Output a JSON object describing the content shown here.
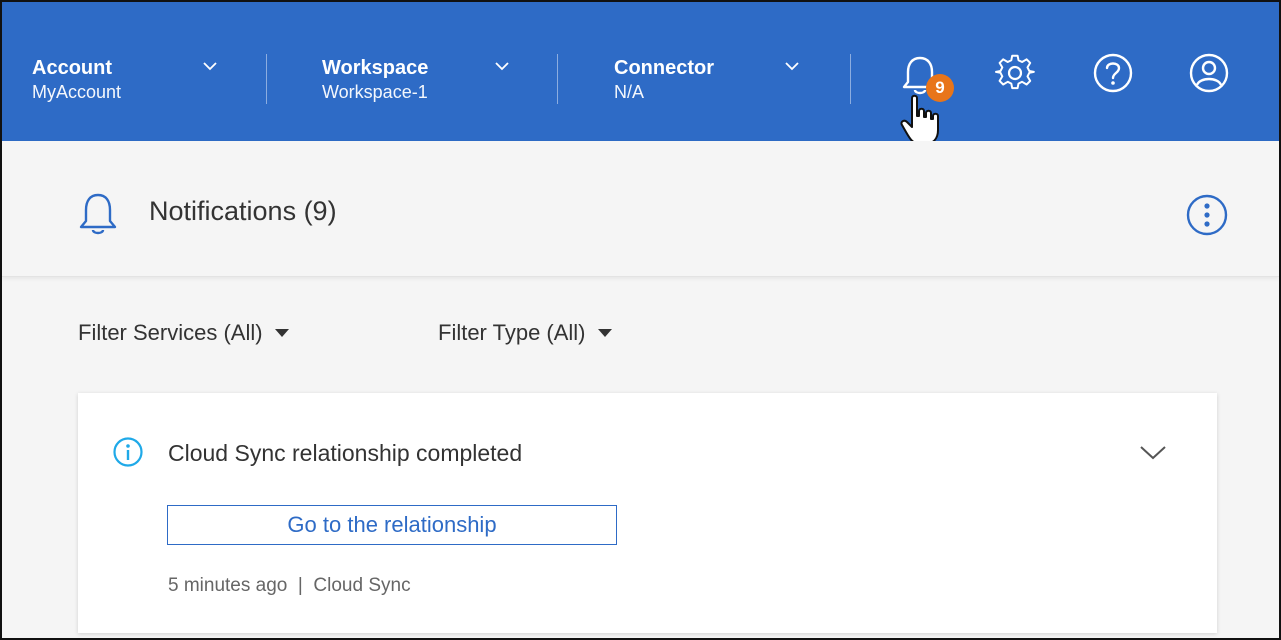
{
  "topbar": {
    "account": {
      "title": "Account",
      "value": "MyAccount"
    },
    "workspace": {
      "title": "Workspace",
      "value": "Workspace-1"
    },
    "connector": {
      "title": "Connector",
      "value": "N/A"
    },
    "notification_count": "9",
    "icons": [
      "bell-icon",
      "gear-icon",
      "help-icon",
      "user-icon"
    ]
  },
  "notifications": {
    "heading": "Notifications (9)",
    "filters": {
      "services": "Filter Services (All)",
      "type": "Filter Type (All)"
    },
    "items": [
      {
        "message": "Cloud Sync relationship completed",
        "action_label": "Go to the relationship",
        "meta": "5 minutes ago  |  Cloud Sync"
      }
    ]
  },
  "colors": {
    "brand": "#2e6bc6",
    "badge": "#e8751a",
    "info": "#1fa9e8"
  }
}
